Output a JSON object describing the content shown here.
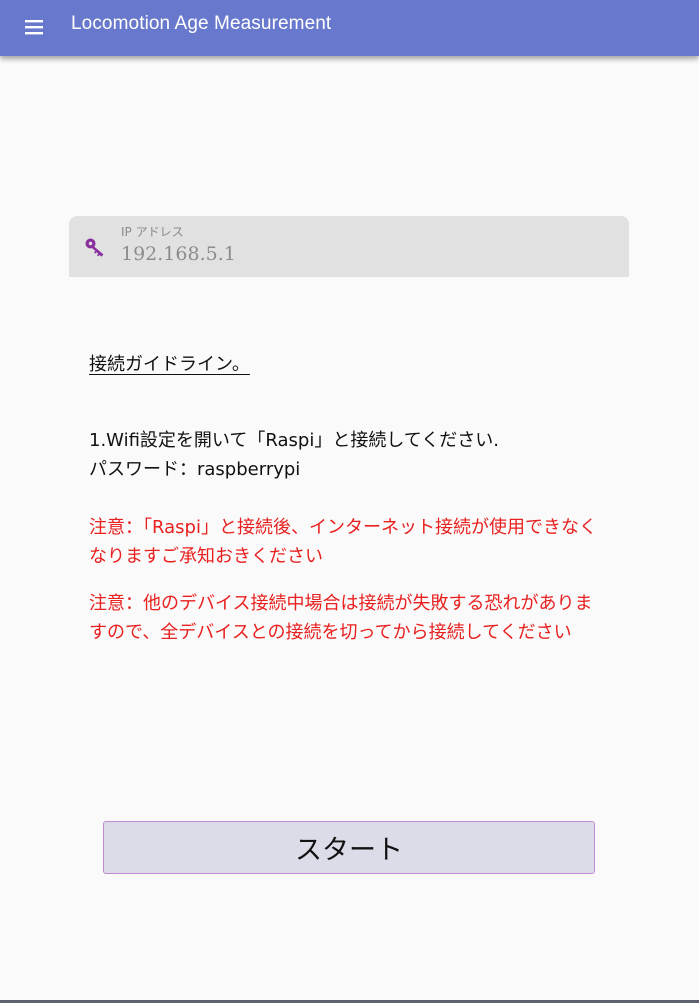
{
  "app_bar": {
    "title": "Locomotion Age Measurement",
    "menu_icon": "hamburger-menu-icon",
    "background_color": "#6878cc"
  },
  "ip_field": {
    "label": "IP アドレス",
    "placeholder": "192.168.5.1",
    "value": "",
    "icon": "key-icon",
    "icon_color": "#8a2f9e"
  },
  "guide": {
    "heading": "接続ガイドライン。",
    "step_1": "1.Wifi設定を開いて「Raspi」と接続してください.\nパスワード：raspberrypi",
    "notices": [
      "注意：「Raspi」と接続後、インターネット接続が使用できなくなりますご承知おきください",
      "注意：他のデバイス接続中場合は接続が失敗する恐れがありますので、全デバイスとの接続を切ってから接続してください"
    ],
    "notice_color": "#e8201f"
  },
  "start_button": {
    "label": "スタート"
  }
}
